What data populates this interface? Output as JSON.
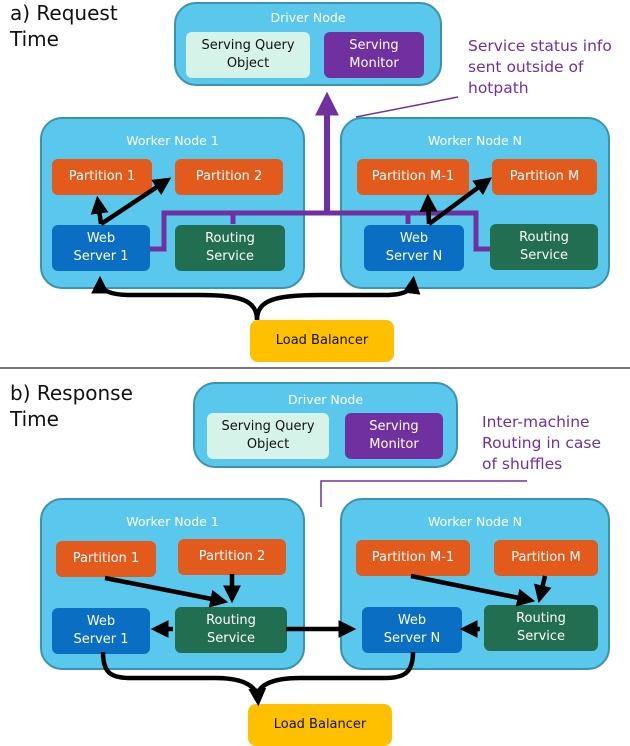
{
  "panels": [
    {
      "id": "request",
      "title": "a) Request\nTime",
      "driver": {
        "title": "Driver Node",
        "query": "Serving Query\nObject",
        "monitor": "Serving\nMonitor"
      },
      "note": "Service status info\nsent outside of\nhotpath",
      "worker1": {
        "title": "Worker Node 1",
        "p1": "Partition 1",
        "p2": "Partition 2",
        "web": "Web\nServer 1",
        "routing": "Routing\nService"
      },
      "workerN": {
        "title": "Worker Node N",
        "p1": "Partition M-1",
        "p2": "Partition M",
        "web": "Web\nServer N",
        "routing": "Routing\nService"
      },
      "load_balancer": "Load Balancer"
    },
    {
      "id": "response",
      "title": "b) Response\nTime",
      "driver": {
        "title": "Driver Node",
        "query": "Serving Query\nObject",
        "monitor": "Serving\nMonitor"
      },
      "note": "Inter-machine\nRouting in case\nof shuffles",
      "worker1": {
        "title": "Worker Node 1",
        "p1": "Partition 1",
        "p2": "Partition 2",
        "web": "Web\nServer 1",
        "routing": "Routing\nService"
      },
      "workerN": {
        "title": "Worker Node N",
        "p1": "Partition M-1",
        "p2": "Partition M",
        "web": "Web\nServer N",
        "routing": "Routing\nService"
      },
      "load_balancer": "Load Balancer"
    }
  ],
  "colors": {
    "node_fill": "#5ac8ec",
    "partition": "#e25a1c",
    "web_server": "#0a6fc2",
    "routing_service": "#226e50",
    "serving_query": "#d6f3ea",
    "serving_monitor": "#7030a0",
    "load_balancer": "#ffc000",
    "status_path": "#7030a0"
  }
}
